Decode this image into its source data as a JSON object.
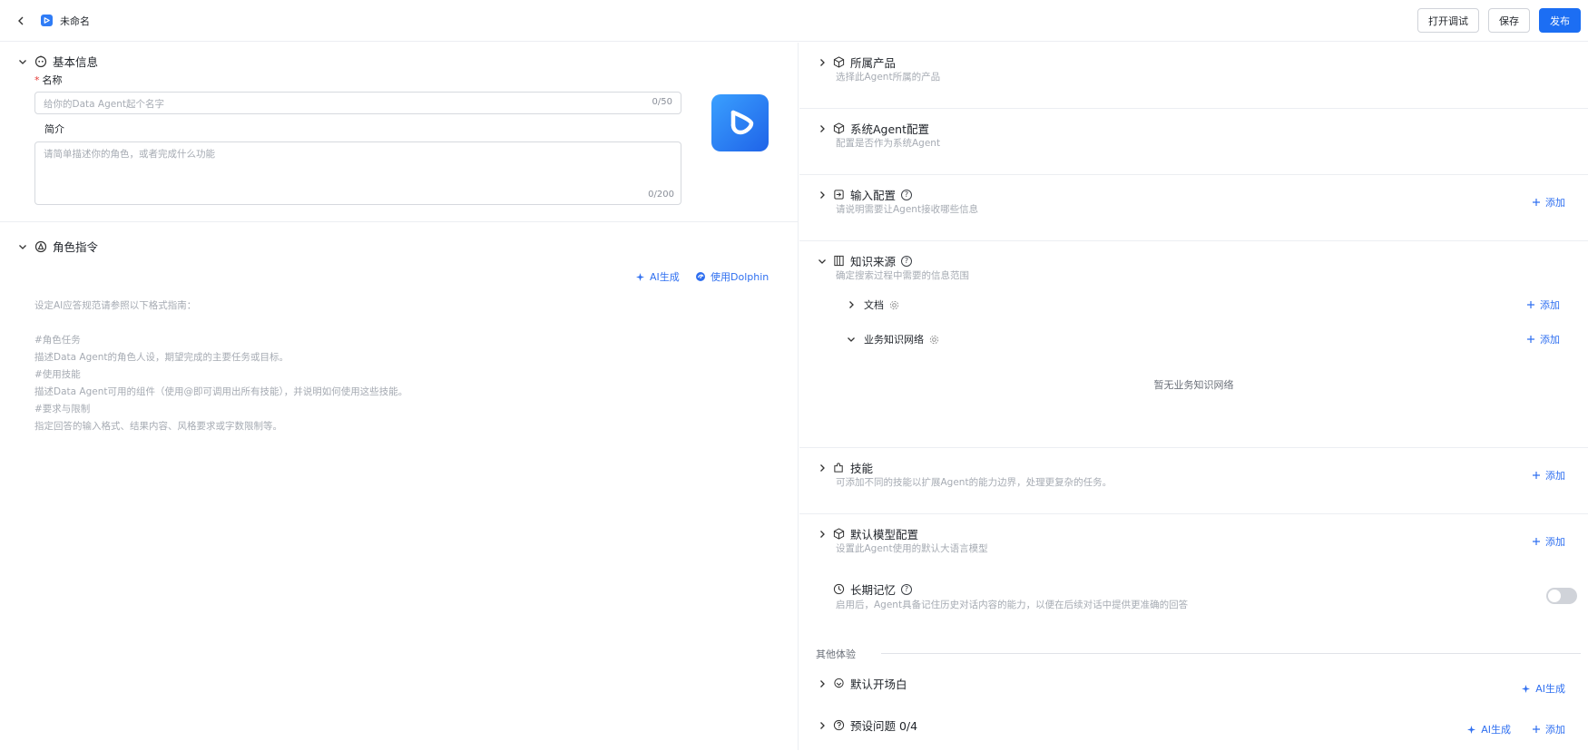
{
  "header": {
    "title": "未命名",
    "debug_label": "打开调试",
    "save_label": "保存",
    "publish_label": "发布"
  },
  "basic_info": {
    "title": "基本信息",
    "name_label": "名称",
    "name_placeholder": "给你的Data Agent起个名字",
    "name_count": "0/50",
    "intro_label": "简介",
    "intro_placeholder": "请简单描述你的角色，或者完成什么功能",
    "intro_count": "0/200"
  },
  "role": {
    "title": "角色指令",
    "ai_generate": "AI生成",
    "use_dolphin": "使用Dolphin",
    "lines": [
      "设定AI应答规范请参照以下格式指南：",
      "",
      "#角色任务",
      "描述Data Agent的角色人设，期望完成的主要任务或目标。",
      "#使用技能",
      "描述Data Agent可用的组件（使用@即可调用出所有技能），并说明如何使用这些技能。",
      "#要求与限制",
      "指定回答的输入格式、结果内容、风格要求或字数限制等。"
    ]
  },
  "right": {
    "product": {
      "title": "所属产品",
      "desc": "选择此Agent所属的产品"
    },
    "system_agent": {
      "title": "系统Agent配置",
      "desc": "配置是否作为系统Agent"
    },
    "input_config": {
      "title": "输入配置",
      "desc": "请说明需要让Agent接收哪些信息",
      "add": "添加"
    },
    "knowledge": {
      "title": "知识来源",
      "desc": "确定搜索过程中需要的信息范围",
      "docs": {
        "title": "文档",
        "add": "添加"
      },
      "network": {
        "title": "业务知识网络",
        "add": "添加",
        "empty": "暂无业务知识网络"
      }
    },
    "skills": {
      "title": "技能",
      "desc": "可添加不同的技能以扩展Agent的能力边界，处理更复杂的任务。",
      "add": "添加"
    },
    "model": {
      "title": "默认模型配置",
      "desc": "设置此Agent使用的默认大语言模型",
      "add": "添加"
    },
    "memory": {
      "title": "长期记忆",
      "desc": "启用后，Agent具备记住历史对话内容的能力，以便在后续对话中提供更准确的回答",
      "enabled": false
    },
    "other_label": "其他体验",
    "opening": {
      "title": "默认开场白",
      "ai_generate": "AI生成"
    },
    "preset": {
      "title": "预设问题 0/4",
      "ai_generate": "AI生成",
      "add": "添加"
    }
  },
  "colors": {
    "primary": "#1c6ef3",
    "link": "#2f6ff0",
    "muted": "#a6abb3"
  }
}
